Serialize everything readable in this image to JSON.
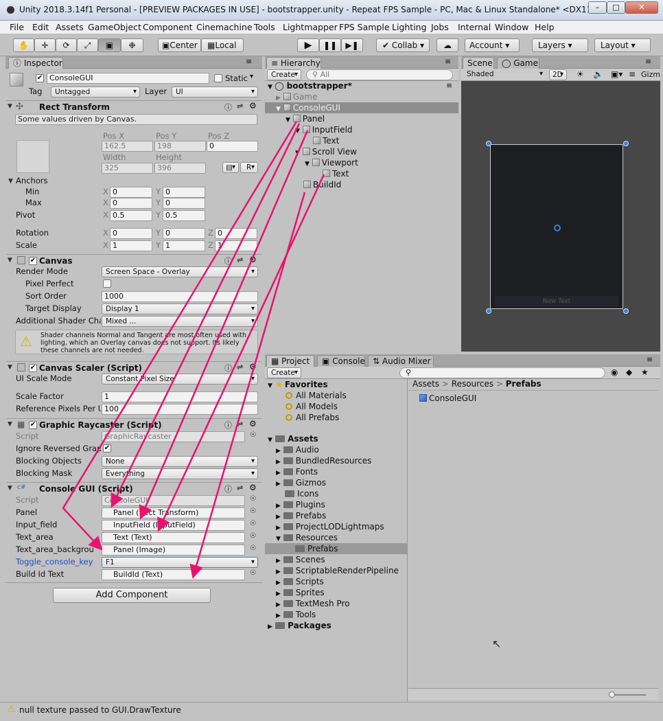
{
  "window": {
    "title": "Unity 2018.3.14f1 Personal - [PREVIEW PACKAGES IN USE] - bootstrapper.unity - Repeat FPS Sample - PC, Mac & Linux Standalone* <DX11>",
    "min": "–",
    "max": "□",
    "close": "✕"
  },
  "menu": [
    "File",
    "Edit",
    "Assets",
    "GameObject",
    "Component",
    "Cinemachine",
    "Tools",
    "Lightmapper",
    "FPS Sample",
    "Lighting",
    "Jobs",
    "Internal",
    "Window",
    "Help"
  ],
  "toolbar": {
    "center": "Center",
    "local": "Local",
    "collab": "Collab",
    "account": "Account",
    "layers": "Layers",
    "layout": "Layout"
  },
  "inspector": {
    "tab": "Inspector",
    "object": {
      "name": "ConsoleGUI",
      "static": "Static",
      "tag_label": "Tag",
      "tag": "Untagged",
      "layer_label": "Layer",
      "layer": "UI"
    },
    "rect": {
      "title": "Rect Transform",
      "note": "Some values driven by Canvas.",
      "pos_x_label": "Pos X",
      "pos_y_label": "Pos Y",
      "pos_z_label": "Pos Z",
      "pos_x": "162.5",
      "pos_y": "198",
      "pos_z": "0",
      "width_label": "Width",
      "height_label": "Height",
      "width": "325",
      "height": "396",
      "r_btn": "R",
      "anchors": "Anchors",
      "min": "Min",
      "max": "Max",
      "pivot": "Pivot",
      "rotation": "Rotation",
      "scale": "Scale",
      "min_x": "0",
      "min_y": "0",
      "max_x": "0",
      "max_y": "0",
      "pivot_x": "0.5",
      "pivot_y": "0.5",
      "rot_x": "0",
      "rot_y": "0",
      "rot_z": "0",
      "scale_x": "1",
      "scale_y": "1",
      "scale_z": "1",
      "x": "X",
      "y": "Y",
      "z": "Z"
    },
    "canvas": {
      "title": "Canvas",
      "render_mode_label": "Render Mode",
      "render_mode": "Screen Space - Overlay",
      "pixel_perfect": "Pixel Perfect",
      "sort_order_label": "Sort Order",
      "sort_order": "1000",
      "target_display_label": "Target Display",
      "target_display": "Display 1",
      "shader_label": "Additional Shader Cha",
      "shader": "Mixed ...",
      "warning": "Shader channels Normal and Tangent are most often used with lighting, which an Overlay canvas does not support. Its likely these channels are not needed."
    },
    "scaler": {
      "title": "Canvas Scaler (Script)",
      "mode_label": "UI Scale Mode",
      "mode": "Constant Pixel Size",
      "factor_label": "Scale Factor",
      "factor": "1",
      "ref_label": "Reference Pixels Per U",
      "ref": "100"
    },
    "raycaster": {
      "title": "Graphic Raycaster (Script)",
      "script_label": "Script",
      "script": "GraphicRaycaster",
      "ignore_label": "Ignore Reversed Grap",
      "blocking_label": "Blocking Objects",
      "blocking": "None",
      "mask_label": "Blocking Mask",
      "mask": "Everything"
    },
    "console": {
      "title": "Console GUI (Script)",
      "script_label": "Script",
      "script": "ConsoleGUI",
      "panel_label": "Panel",
      "panel": "Panel (Rect Transform)",
      "input_label": "Input_field",
      "input": "InputField (InputField)",
      "text_label": "Text_area",
      "text": "Text (Text)",
      "bg_label": "Text_area_backgrou",
      "bg": "Panel (Image)",
      "toggle_label": "Toggle_console_key",
      "toggle": "F1",
      "build_label": "Build Id Text",
      "build": "BuildId (Text)"
    },
    "add_component": "Add Component"
  },
  "hierarchy": {
    "tab": "Hierarchy",
    "create": "Create",
    "search_placeholder": "All",
    "scene": "bootstrapper*",
    "items": [
      "Game",
      "ConsoleGUI",
      "Panel",
      "InputField",
      "Text",
      "Scroll View",
      "Viewport",
      "Text",
      "BuildId"
    ]
  },
  "scene": {
    "tab_scene": "Scene",
    "tab_game": "Game",
    "shaded": "Shaded",
    "mode2d": "2D",
    "gizmos": "Gizm",
    "canvas_text": "New Text"
  },
  "project": {
    "tab_project": "Project",
    "tab_console": "Console",
    "tab_audio": "Audio Mixer",
    "create": "Create",
    "favorites": "Favorites",
    "fav_items": [
      "All Materials",
      "All Models",
      "All Prefabs"
    ],
    "assets": "Assets",
    "folders": [
      "Audio",
      "BundledResources",
      "Fonts",
      "Gizmos",
      "Icons",
      "Plugins",
      "Prefabs",
      "ProjectLODLightmaps",
      "Resources",
      "Prefabs",
      "Scenes",
      "ScriptableRenderPipeline",
      "Scripts",
      "Sprites",
      "TextMesh Pro",
      "Tools"
    ],
    "packages": "Packages",
    "breadcrumb": [
      "Assets",
      "Resources",
      "Prefabs"
    ],
    "file": "ConsoleGUI"
  },
  "status": {
    "message": "null texture passed to GUI.DrawTexture"
  },
  "colors": {
    "arrow": "#e8136f",
    "scene_bg": "#4a4a4a",
    "canvas": "#1d1e22"
  }
}
